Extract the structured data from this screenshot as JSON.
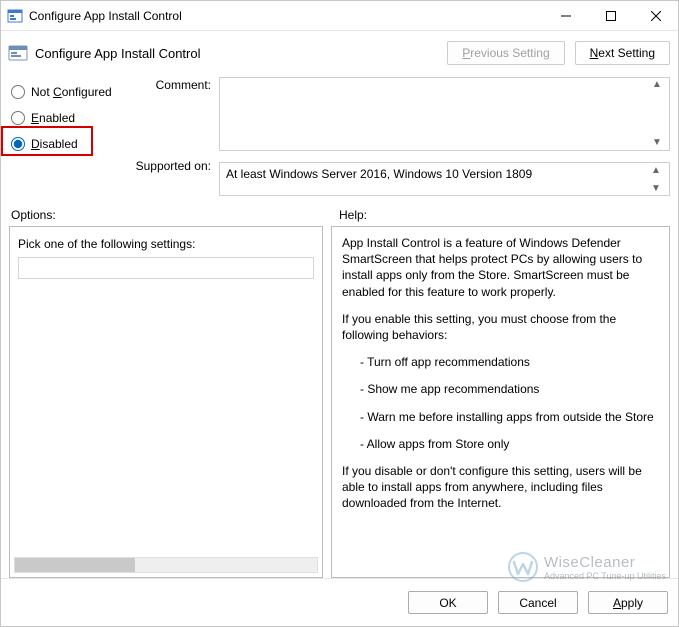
{
  "window": {
    "title": "Configure App Install Control"
  },
  "header": {
    "title": "Configure App Install Control",
    "prev_btn": "Previous Setting",
    "next_btn": "Next Setting"
  },
  "radios": {
    "not_configured": "Not Configured",
    "enabled": "Enabled",
    "disabled": "Disabled",
    "selected": "disabled"
  },
  "labels": {
    "comment": "Comment:",
    "supported": "Supported on:",
    "options": "Options:",
    "help": "Help:"
  },
  "comment_value": "",
  "supported_on": "At least Windows Server 2016, Windows 10 Version 1809",
  "options_pane": {
    "pick_label": "Pick one of the following settings:",
    "combo_value": ""
  },
  "help_text": {
    "p1": "App Install Control is a feature of Windows Defender SmartScreen that helps protect PCs by allowing users to install apps only from the Store.  SmartScreen must be enabled for this feature to work properly.",
    "p2": "If you enable this setting, you must choose from the following behaviors:",
    "b1": "- Turn off app recommendations",
    "b2": "- Show me app recommendations",
    "b3": "- Warn me before installing apps from outside the Store",
    "b4": "- Allow apps from Store only",
    "p3": "If you disable or don't configure this setting, users will be able to install apps from anywhere, including files downloaded from the Internet."
  },
  "footer": {
    "ok": "OK",
    "cancel": "Cancel",
    "apply": "Apply"
  },
  "watermark": {
    "line1": "WiseCleaner",
    "line2": "Advanced PC Tune-up Utilities"
  }
}
